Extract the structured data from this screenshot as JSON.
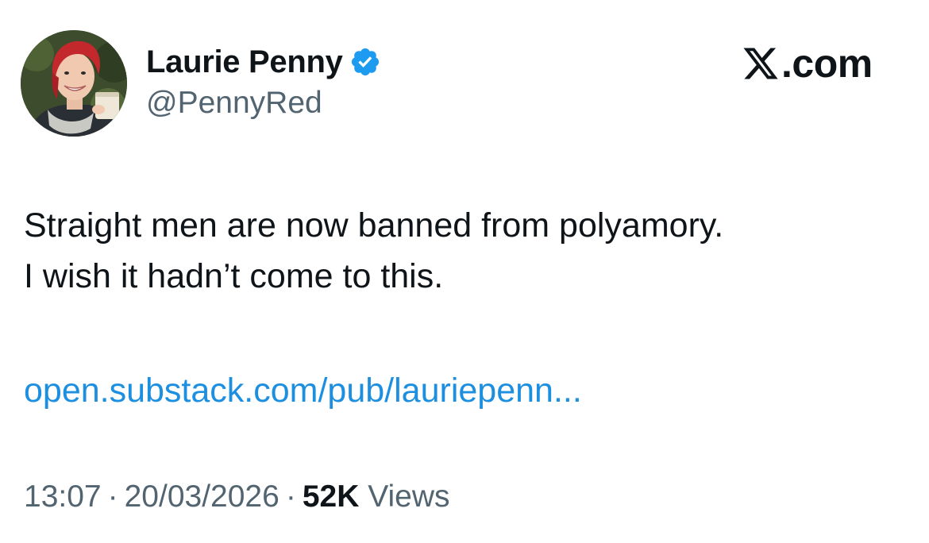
{
  "author": {
    "display_name": "Laurie Penny",
    "handle": "@PennyRed",
    "verified_icon": "verified-badge-icon",
    "avatar": "profile-photo"
  },
  "brand": {
    "icon": "x-logo-icon",
    "suffix": ".com"
  },
  "tweet": {
    "lines": [
      "Straight men are now banned from polyamory.",
      "I wish it hadn’t come to this."
    ],
    "link_text": "open.substack.com/pub/lauriepenn..."
  },
  "meta": {
    "time": "13:07",
    "separator": "·",
    "date": "20/03/2026",
    "views_count": "52K",
    "views_label": "Views"
  },
  "colors": {
    "text": "#0f1419",
    "secondary": "#536471",
    "link": "#1d8fe0",
    "verified": "#1d9bf0"
  }
}
